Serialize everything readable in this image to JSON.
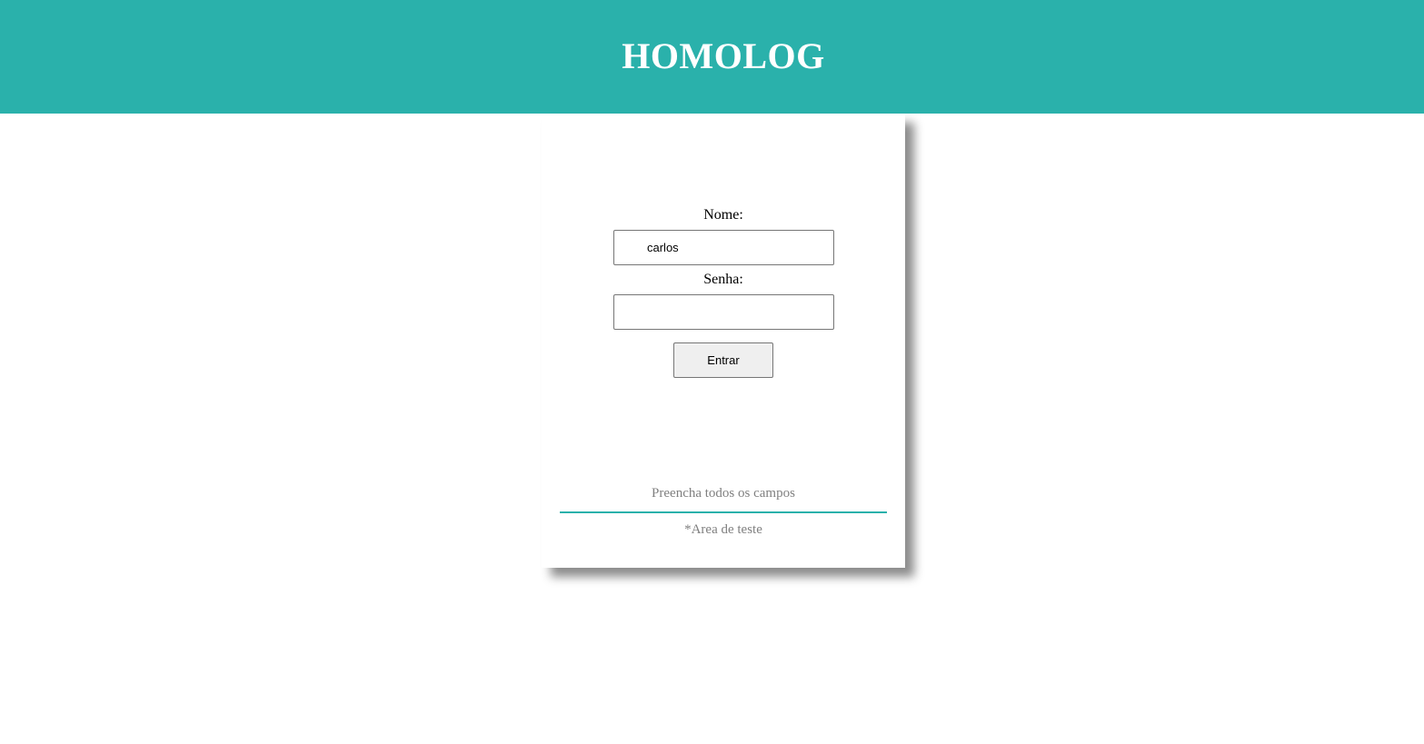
{
  "header": {
    "title": "HOMOLOG"
  },
  "login": {
    "name_label": "Nome:",
    "name_value": "carlos",
    "password_label": "Senha:",
    "password_value": "",
    "submit_label": "Entrar"
  },
  "status": {
    "message": "Preencha todos os campos",
    "footnote": "*Area de teste"
  },
  "colors": {
    "accent": "#2ab1ab",
    "background": "#ffffff",
    "muted_text": "#808080"
  }
}
